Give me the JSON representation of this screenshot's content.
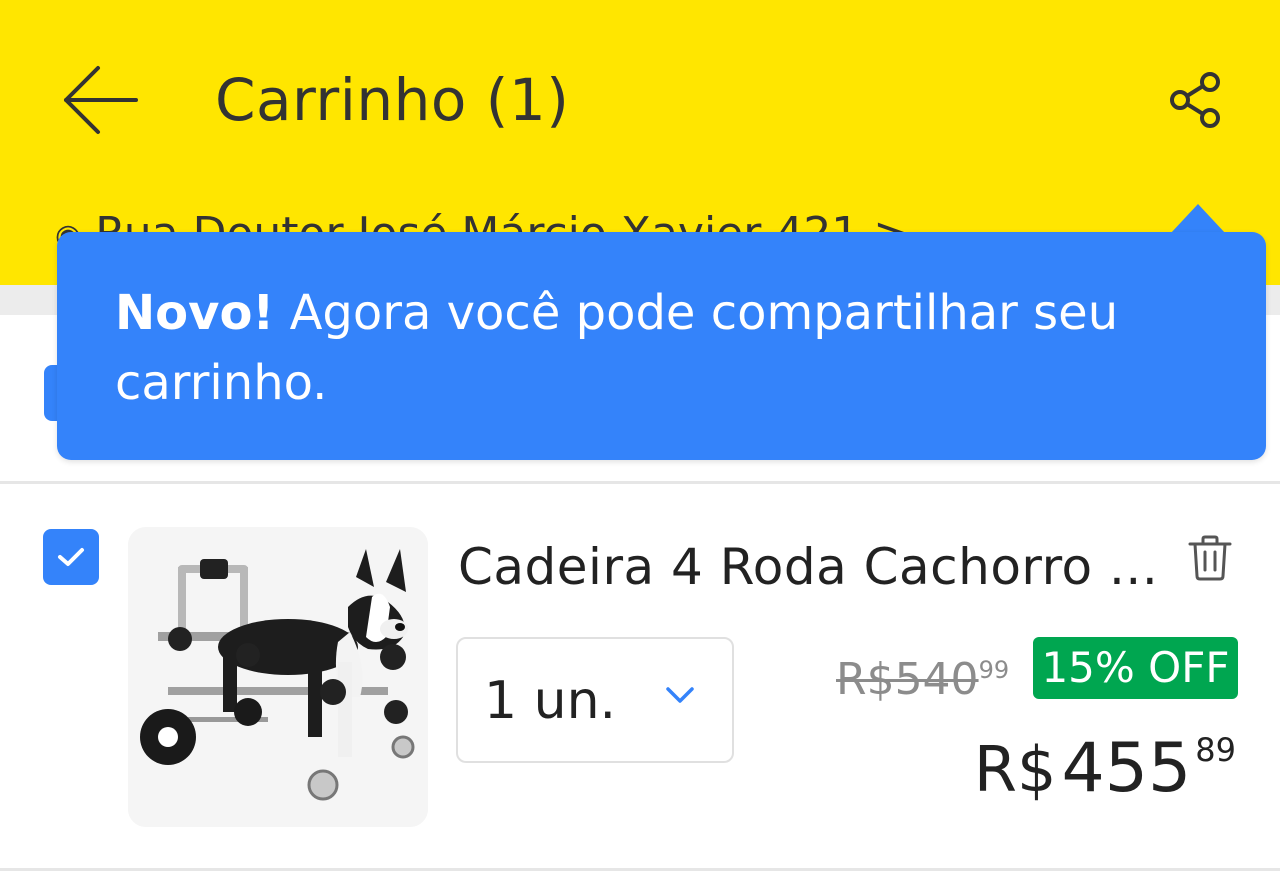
{
  "header": {
    "title": "Carrinho (1)",
    "address": "Rua Doutor José Márcio Xavier 421 >",
    "bg_color": "#ffe600"
  },
  "tooltip": {
    "bold_text": "Novo!",
    "text": " Agora você pode compartilhar seu carrinho.",
    "bg_color": "#3483fa"
  },
  "icons": {
    "back": "arrow-left-icon",
    "share": "share-icon",
    "location": "location-pin-icon",
    "checkbox": "checkmark-icon",
    "trash": "trash-icon",
    "chevron": "chevron-down-icon"
  },
  "item": {
    "name": "Cadeira 4 Roda Cachorro ...",
    "checked": true,
    "quantity": "1 un.",
    "old_price": {
      "main": "R$540",
      "cents": "99"
    },
    "discount": "15% OFF",
    "price": {
      "currency": "R$",
      "integer": "455",
      "cents": "89"
    },
    "discount_color": "#00a650"
  }
}
